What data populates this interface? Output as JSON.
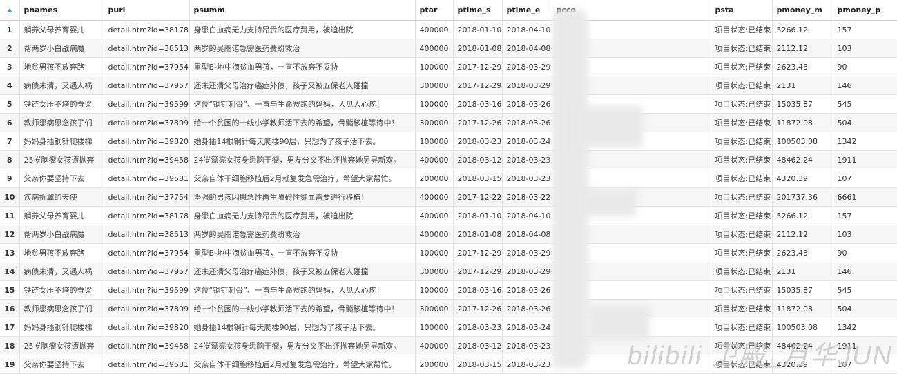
{
  "columns": [
    "pnames",
    "purl",
    "psumm",
    "ptar",
    "ptime_s",
    "ptime_e",
    "pcco",
    "psta",
    "pmoney_m",
    "pmoney_p"
  ],
  "rows": [
    {
      "n": "1",
      "pnames": "躺养父母养育婴儿",
      "purl": "detail.htm?id=38178",
      "psumm": "身患白血病无力支持昂贵的医疗费用，被迫出院",
      "ptar": "400000",
      "ptime_s": "2018-01-10",
      "ptime_e": "2018-04-10",
      "psta": "项目状态:已结束",
      "pmoney_m": "5266.12",
      "pmoney_p": "157"
    },
    {
      "n": "2",
      "pnames": "帮两岁小白战病魔",
      "purl": "detail.htm?id=38513",
      "psumm": "两岁的吴雨诺急需医药费盼救治",
      "ptar": "400000",
      "ptime_s": "2018-01-08",
      "ptime_e": "2018-04-08",
      "psta": "项目状态:已结束",
      "pmoney_m": "2112.12",
      "pmoney_p": "103"
    },
    {
      "n": "3",
      "pnames": "地贫男孩不放弃路",
      "purl": "detail.htm?id=37954",
      "psumm": "重型B-地中海贫血男孩，一直不放弃不妥协",
      "ptar": "100000",
      "ptime_s": "2017-12-29",
      "ptime_e": "2018-03-29",
      "psta": "项目状态:已结束",
      "pmoney_m": "2623.43",
      "pmoney_p": "90"
    },
    {
      "n": "4",
      "pnames": "病债未清，又遇人祸",
      "purl": "detail.htm?id=37957",
      "psumm": "还未还清父母治疗癌症外债，孩子又被五保老人碰撞",
      "ptar": "300000",
      "ptime_s": "2017-12-29",
      "ptime_e": "2018-03-29",
      "psta": "项目状态:已结束",
      "pmoney_m": "2131",
      "pmoney_p": "146"
    },
    {
      "n": "5",
      "pnames": "铁链女压不垮的脊梁",
      "purl": "detail.htm?id=39599",
      "psumm": "这位“钢钉刺骨”、一直与生命赛跑的妈妈，人见人心疼！",
      "ptar": "100000",
      "ptime_s": "2018-03-16",
      "ptime_e": "2018-03-26",
      "psta": "项目状态:已结束",
      "pmoney_m": "15035.87",
      "pmoney_p": "545"
    },
    {
      "n": "6",
      "pnames": "教师患病思念孩子们",
      "purl": "detail.htm?id=37809",
      "psumm": "给一个贫困的一线小学教师活下去的希望，骨髓移植等待中！",
      "ptar": "300000",
      "ptime_s": "2017-12-26",
      "ptime_e": "2018-03-26",
      "psta": "项目状态:已结束",
      "pmoney_m": "11872.08",
      "pmoney_p": "504"
    },
    {
      "n": "7",
      "pnames": "妈妈身插钢针爬楼梯",
      "purl": "detail.htm?id=39820",
      "psumm": "她身插14根钢针每天爬楼90层，只想为了孩子活下去。",
      "ptar": "100000",
      "ptime_s": "2018-03-23",
      "ptime_e": "2018-03-24",
      "psta": "项目状态:已结束",
      "pmoney_m": "100503.08",
      "pmoney_p": "1342"
    },
    {
      "n": "8",
      "pnames": "25岁脑瘤女孩遭抛弃",
      "purl": "detail.htm?id=39458",
      "psumm": "24岁漂亮女孩身患脑干瘤，男友分文不出还抛弃她另寻新欢。",
      "ptar": "400000",
      "ptime_s": "2018-03-12",
      "ptime_e": "2018-03-23",
      "psta": "项目状态:已结束",
      "pmoney_m": "48462.24",
      "pmoney_p": "1911"
    },
    {
      "n": "9",
      "pnames": "父亲你要坚持下去",
      "purl": "detail.htm?id=39581",
      "psumm": "父亲自体干细胞移植后2月就复发急需治疗，希望大家帮忙。",
      "ptar": "200000",
      "ptime_s": "2018-03-15",
      "ptime_e": "2018-03-23",
      "psta": "项目状态:已结束",
      "pmoney_m": "4320.39",
      "pmoney_p": "107"
    },
    {
      "n": "10",
      "pnames": "疾病折翼的天使",
      "purl": "detail.htm?id=37754",
      "psumm": "坚强的男孩因患急性再生障碍性贫血需要进行移植！",
      "ptar": "400000",
      "ptime_s": "2017-12-22",
      "ptime_e": "2018-03-22",
      "psta": "项目状态:已结束",
      "pmoney_m": "201737.36",
      "pmoney_p": "6661"
    },
    {
      "n": "11",
      "pnames": "躺养父母养育婴儿",
      "purl": "detail.htm?id=38178",
      "psumm": "身患白血病无力支持昂贵的医疗费用，被迫出院",
      "ptar": "400000",
      "ptime_s": "2018-01-10",
      "ptime_e": "2018-04-10",
      "psta": "项目状态:已结束",
      "pmoney_m": "5266.12",
      "pmoney_p": "157"
    },
    {
      "n": "12",
      "pnames": "帮两岁小白战病魔",
      "purl": "detail.htm?id=38513",
      "psumm": "两岁的吴雨诺急需医药费盼救治",
      "ptar": "400000",
      "ptime_s": "2018-01-08",
      "ptime_e": "2018-04-08",
      "psta": "项目状态:已结束",
      "pmoney_m": "2112.12",
      "pmoney_p": "103"
    },
    {
      "n": "13",
      "pnames": "地贫男孩不放弃路",
      "purl": "detail.htm?id=37954",
      "psumm": "重型B-地中海贫血男孩，一直不放弃不妥协",
      "ptar": "100000",
      "ptime_s": "2017-12-29",
      "ptime_e": "2018-03-29",
      "psta": "项目状态:已结束",
      "pmoney_m": "2623.43",
      "pmoney_p": "90"
    },
    {
      "n": "14",
      "pnames": "病债未清，又遇人祸",
      "purl": "detail.htm?id=37957",
      "psumm": "还未还清父母治疗癌症外债，孩子又被五保老人碰撞",
      "ptar": "300000",
      "ptime_s": "2017-12-29",
      "ptime_e": "2018-03-29",
      "psta": "项目状态:已结束",
      "pmoney_m": "2131",
      "pmoney_p": "146"
    },
    {
      "n": "15",
      "pnames": "铁链女压不垮的脊梁",
      "purl": "detail.htm?id=39599",
      "psumm": "这位“钢钉刺骨”、一直与生命赛跑的妈妈，人见人心疼！",
      "ptar": "100000",
      "ptime_s": "2018-03-16",
      "ptime_e": "2018-03-26",
      "psta": "项目状态:已结束",
      "pmoney_m": "15035.87",
      "pmoney_p": "545"
    },
    {
      "n": "16",
      "pnames": "教师患病思念孩子们",
      "purl": "detail.htm?id=37809",
      "psumm": "给一个贫困的一线小学教师活下去的希望，骨髓移植等待中！",
      "ptar": "300000",
      "ptime_s": "2017-12-26",
      "ptime_e": "2018-03-26",
      "psta": "项目状态:已结束",
      "pmoney_m": "11872.08",
      "pmoney_p": "504"
    },
    {
      "n": "17",
      "pnames": "妈妈身插钢针爬楼梯",
      "purl": "detail.htm?id=39820",
      "psumm": "她身插14根钢针每天爬楼90层，只想为了孩子活下去。",
      "ptar": "100000",
      "ptime_s": "2018-03-23",
      "ptime_e": "2018-03-24",
      "psta": "项目状态:已结束",
      "pmoney_m": "100503.08",
      "pmoney_p": "1342"
    },
    {
      "n": "18",
      "pnames": "25岁脑瘤女孩遭抛弃",
      "purl": "detail.htm?id=39458",
      "psumm": "24岁漂亮女孩身患脑干瘤，男友分文不出还抛弃她另寻新欢。",
      "ptar": "400000",
      "ptime_s": "2018-03-12",
      "ptime_e": "2018-03-23",
      "psta": "项目状态:已结束",
      "pmoney_m": "48462.24",
      "pmoney_p": "1911"
    },
    {
      "n": "19",
      "pnames": "父亲你要坚持下去",
      "purl": "detail.htm?id=39581",
      "psumm": "父亲自体干细胞移植后2月就复发急需治疗，希望大家帮忙。",
      "ptar": "200000",
      "ptime_s": "2018-03-15",
      "ptime_e": "2018-03-23",
      "psta": "项目状态:已结束",
      "pmoney_m": "4320.39",
      "pmoney_p": "107"
    }
  ],
  "watermark": "bilibili 卫殿_月华JUN"
}
